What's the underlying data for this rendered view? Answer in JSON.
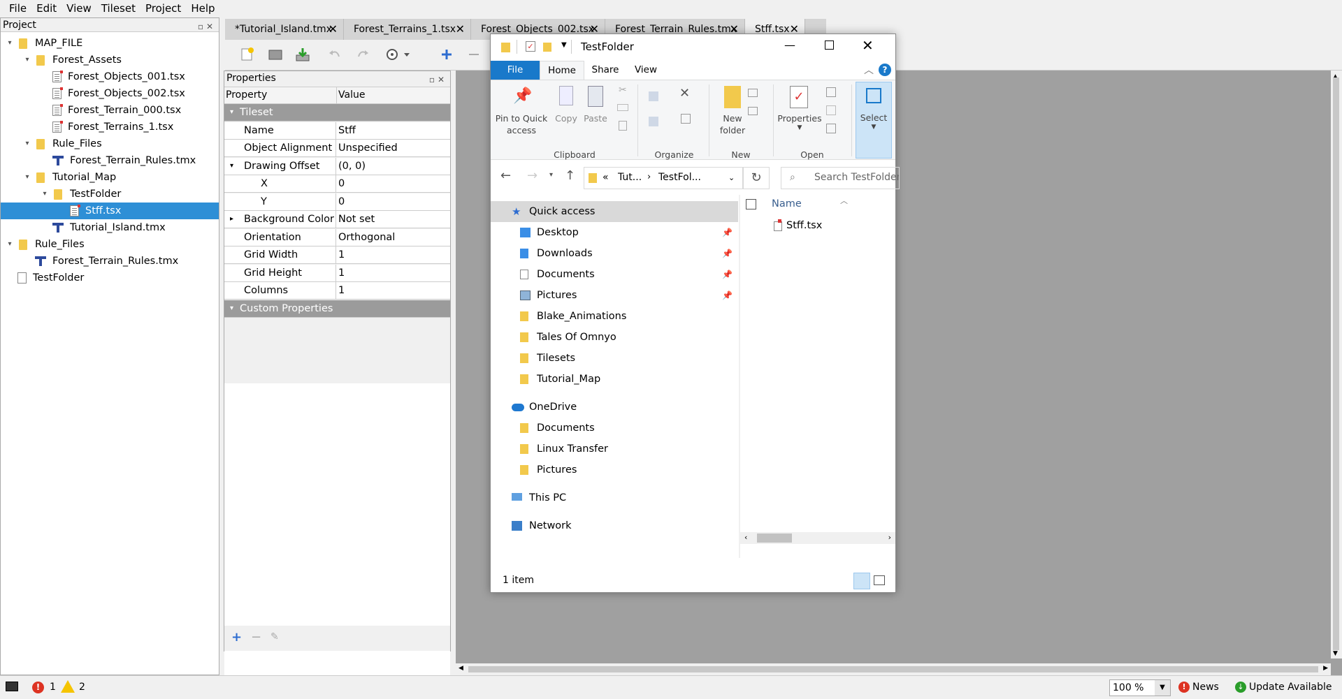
{
  "menu": [
    "File",
    "Edit",
    "View",
    "Tileset",
    "Project",
    "Help"
  ],
  "project": {
    "title": "Project",
    "tree": [
      {
        "label": "MAP_FILE",
        "type": "folder"
      },
      {
        "label": "Forest_Assets",
        "type": "folder"
      },
      {
        "label": "Forest_Objects_001.tsx",
        "type": "tsx"
      },
      {
        "label": "Forest_Objects_002.tsx",
        "type": "tsx"
      },
      {
        "label": "Forest_Terrain_000.tsx",
        "type": "tsx"
      },
      {
        "label": "Forest_Terrains_1.tsx",
        "type": "tsx"
      },
      {
        "label": "Rule_Files",
        "type": "folder"
      },
      {
        "label": "Forest_Terrain_Rules.tmx",
        "type": "tmx"
      },
      {
        "label": "Tutorial_Map",
        "type": "folder"
      },
      {
        "label": "TestFolder",
        "type": "folder"
      },
      {
        "label": "Stff.tsx",
        "type": "tsx",
        "selected": true
      },
      {
        "label": "Tutorial_Island.tmx",
        "type": "tmx"
      },
      {
        "label": "Rule_Files",
        "type": "folder"
      },
      {
        "label": "Forest_Terrain_Rules.tmx",
        "type": "tmx"
      },
      {
        "label": "TestFolder",
        "type": "file"
      }
    ]
  },
  "tabs": [
    {
      "label": "*Tutorial_Island.tmx"
    },
    {
      "label": "Forest_Terrains_1.tsx"
    },
    {
      "label": "Forest_Objects_002.tsx"
    },
    {
      "label": "Forest_Terrain_Rules.tmx"
    },
    {
      "label": "Stff.tsx",
      "active": true
    }
  ],
  "properties": {
    "title": "Properties",
    "col_property": "Property",
    "col_value": "Value",
    "rows": [
      {
        "key": "Tileset",
        "value": "",
        "group": true
      },
      {
        "key": "Name",
        "value": "Stff"
      },
      {
        "key": "Object Alignment",
        "value": "Unspecified"
      },
      {
        "key": "Drawing Offset",
        "value": "(0, 0)"
      },
      {
        "key": "X",
        "value": "0"
      },
      {
        "key": "Y",
        "value": "0"
      },
      {
        "key": "Background Color",
        "value": "Not set"
      },
      {
        "key": "Orientation",
        "value": "Orthogonal"
      },
      {
        "key": "Grid Width",
        "value": "1"
      },
      {
        "key": "Grid Height",
        "value": "1"
      },
      {
        "key": "Columns",
        "value": "1"
      },
      {
        "key": "Custom Properties",
        "value": "",
        "group": true
      }
    ]
  },
  "status": {
    "errors": "1",
    "warnings": "2",
    "zoom": "100 %",
    "news": "News",
    "update": "Update Available"
  },
  "explorer": {
    "title": "TestFolder",
    "ribbon_tabs": [
      "File",
      "Home",
      "Share",
      "View"
    ],
    "ribbon": {
      "pin_line1": "Pin to Quick",
      "pin_line2": "access",
      "copy": "Copy",
      "paste": "Paste",
      "clipboard": "Clipboard",
      "organize": "Organize",
      "new_line1": "New",
      "new_line2": "folder",
      "new": "New",
      "properties": "Properties",
      "open": "Open",
      "select": "Select"
    },
    "address": {
      "part1": "Tut...",
      "part2": "TestFol..."
    },
    "search_placeholder": "Search TestFolder",
    "nav": [
      {
        "label": "Quick access",
        "icon": "star-icon",
        "level": 0,
        "selected": true
      },
      {
        "label": "Desktop",
        "icon": "desktop-icon",
        "level": 1,
        "pinned": true
      },
      {
        "label": "Downloads",
        "icon": "download-icon",
        "level": 1,
        "pinned": true
      },
      {
        "label": "Documents",
        "icon": "documents-icon",
        "level": 1,
        "pinned": true
      },
      {
        "label": "Pictures",
        "icon": "pictures-icon",
        "level": 1,
        "pinned": true
      },
      {
        "label": "Blake_Animations",
        "icon": "folder-icon",
        "level": 1
      },
      {
        "label": "Tales Of Omnyo",
        "icon": "folder-icon",
        "level": 1
      },
      {
        "label": "Tilesets",
        "icon": "folder-icon",
        "level": 1
      },
      {
        "label": "Tutorial_Map",
        "icon": "folder-icon",
        "level": 1
      },
      {
        "label": "OneDrive",
        "icon": "cloud-icon",
        "level": 0
      },
      {
        "label": "Documents",
        "icon": "folder-icon",
        "level": 1
      },
      {
        "label": "Linux Transfer",
        "icon": "folder-icon",
        "level": 1
      },
      {
        "label": "Pictures",
        "icon": "folder-icon",
        "level": 1
      },
      {
        "label": "This PC",
        "icon": "computer-icon",
        "level": 0
      },
      {
        "label": "Network",
        "icon": "network-icon",
        "level": 0
      }
    ],
    "column_name": "Name",
    "files": [
      {
        "label": "Stff.tsx"
      }
    ],
    "item_count": "1 item"
  },
  "colors": {
    "selection": "#2e8fd6",
    "file_tab": "#1979ca",
    "canvas": "#a0a0a0",
    "group_row": "#9b9b9b"
  }
}
